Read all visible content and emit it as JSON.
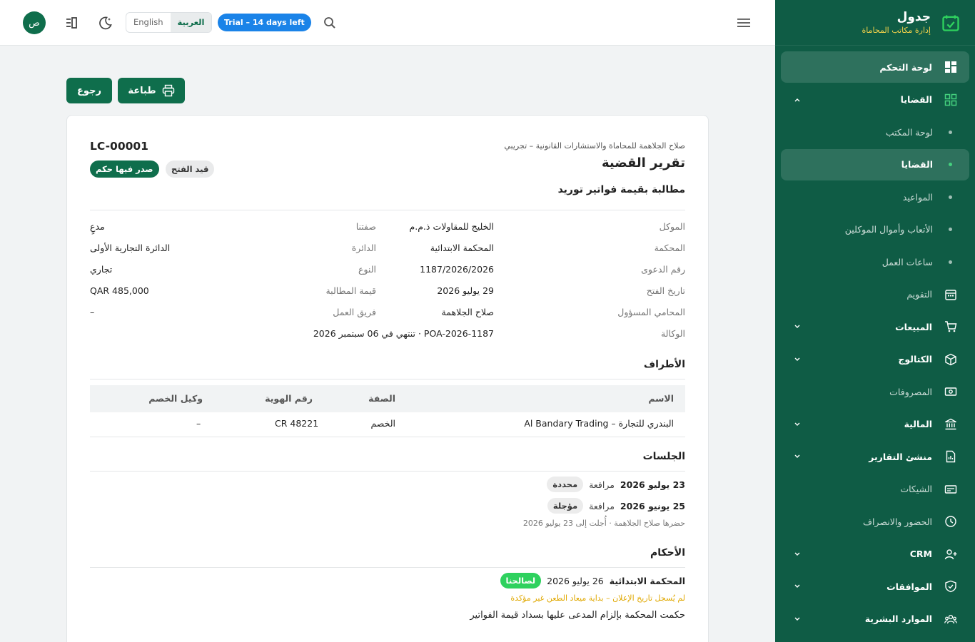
{
  "brand": {
    "title": "جدول",
    "subtitle": "إدارة مكاتب المحاماة"
  },
  "topbar": {
    "avatar_letter": "ص",
    "lang_english": "English",
    "lang_arabic": "العربية",
    "trial": "Trial – 14 days left"
  },
  "sidebar": {
    "items": [
      {
        "label": "لوحة التحكم",
        "icon": "dashboard-icon"
      },
      {
        "label": "القضايا",
        "icon": "cases-icon"
      },
      {
        "label": "لوحة المكتب"
      },
      {
        "label": "القضايا"
      },
      {
        "label": "المواعيد"
      },
      {
        "label": "الأتعاب وأموال الموكلين"
      },
      {
        "label": "ساعات العمل"
      },
      {
        "label": "التقويم",
        "icon": "calendar-icon"
      },
      {
        "label": "المبيعات",
        "icon": "cart-icon"
      },
      {
        "label": "الكتالوج",
        "icon": "box-icon"
      },
      {
        "label": "المصروفات",
        "icon": "expenses-icon"
      },
      {
        "label": "المالية",
        "icon": "bank-icon"
      },
      {
        "label": "منشئ التقارير",
        "icon": "report-icon"
      },
      {
        "label": "الشيكات",
        "icon": "cheque-icon"
      },
      {
        "label": "الحضور والانصراف",
        "icon": "clock-icon"
      },
      {
        "label": "CRM",
        "icon": "user-add-icon"
      },
      {
        "label": "الموافقات",
        "icon": "shield-check-icon"
      },
      {
        "label": "الموارد البشرية",
        "icon": "people-icon"
      }
    ]
  },
  "actions": {
    "print": "طباعة",
    "back": "رجوع"
  },
  "report": {
    "firm": "صلاح الجلاهمة للمحاماة والاستشارات القانونية – تجريبي",
    "title": "تقرير القضية",
    "subject": "مطالبة بقيمة فواتير توريد",
    "code": "LC-00001",
    "badge_judgment": "صدر فيها حكم",
    "badge_open": "قيد الفتح"
  },
  "details": {
    "client_label": "الموكل",
    "client_value": "الخليج للمقاولات ذ.م.م",
    "capacity_label": "صفتنا",
    "capacity_value": "مدعٍ",
    "court_label": "المحكمة",
    "court_value": "المحكمة الابتدائية",
    "circuit_label": "الدائرة",
    "circuit_value": "الدائرة التجارية الأولى",
    "case_no_label": "رقم الدعوى",
    "case_no_value": "1187/2026/2026",
    "type_label": "النوع",
    "type_value": "تجاري",
    "open_date_label": "تاريخ الفتح",
    "open_date_value": "29 يوليو 2026",
    "claim_label": "قيمة المطالبة",
    "claim_value": "QAR 485,000",
    "lawyer_label": "المحامي المسؤول",
    "lawyer_value": "صلاح الجلاهمة",
    "team_label": "فريق العمل",
    "team_value": "–",
    "poa_label": "الوكالة",
    "poa_value": "POA-2026-1187 · تنتهي في 06 سبتمبر 2026"
  },
  "parties": {
    "title": "الأطراف",
    "columns": [
      "الاسم",
      "الصفة",
      "رقم الهوية",
      "وكيل الخصم"
    ],
    "rows": [
      {
        "name": "البندري للتجارة – Al Bandary Trading",
        "role": "الخصم",
        "id": "CR 48221",
        "agent": "–"
      }
    ]
  },
  "sessions": {
    "title": "الجلسات",
    "items": [
      {
        "date": "23 يوليو 2026",
        "kind": "مرافعة",
        "status": "محددة",
        "note": ""
      },
      {
        "date": "25 يونيو 2026",
        "kind": "مرافعة",
        "status": "مؤجلة",
        "note": "حضرها صلاح الجلاهمة · أُجلت إلى 23 يوليو 2026"
      }
    ]
  },
  "judgments": {
    "title": "الأحكام",
    "court": "المحكمة الابتدائية",
    "date": "26 يوليو 2026",
    "result": "لصالحنا",
    "warning": "لم يُسجل تاريخ الإعلان – بداية ميعاد الطعن غير مؤكدة",
    "text": "حكمت المحكمة بإلزام المدعى عليها بسداد قيمة الفواتير"
  },
  "colors": {
    "primary": "#0f6e4c",
    "sidebar": "#0f5c45",
    "accent_yellow": "#f5d34a",
    "trial_blue": "#1a83e8",
    "success": "#2ed15e"
  }
}
